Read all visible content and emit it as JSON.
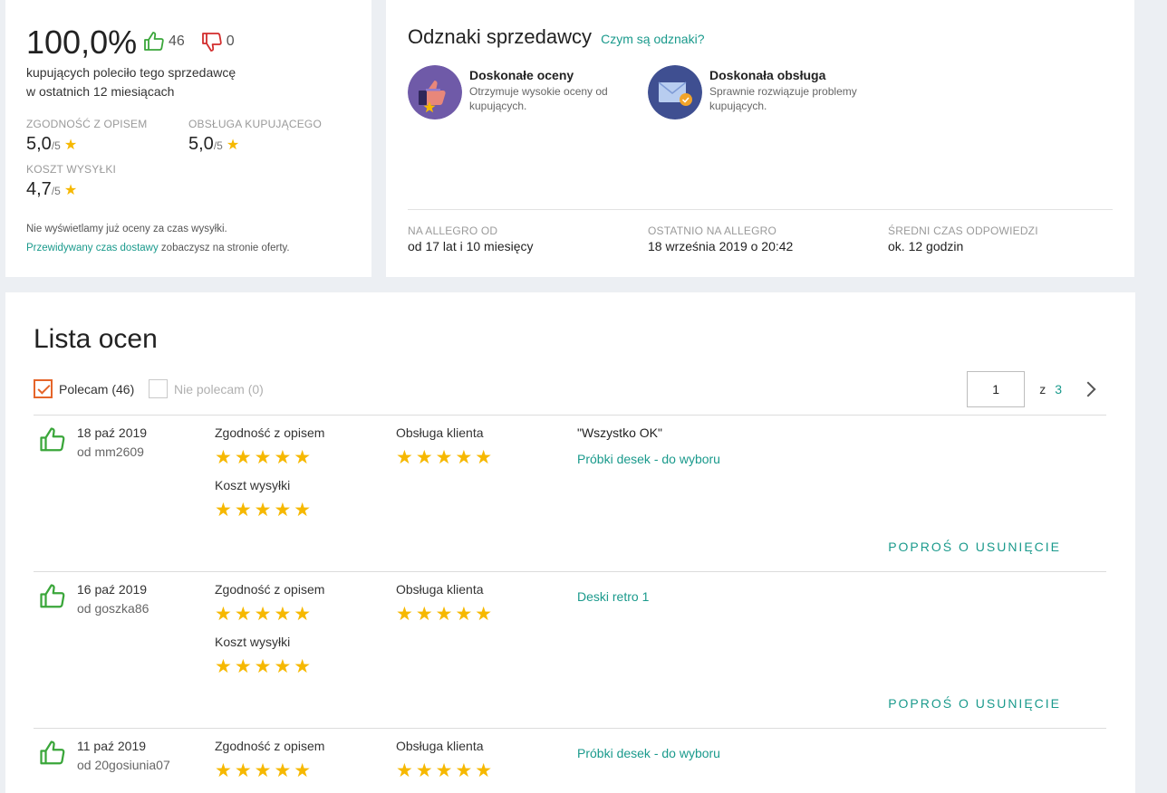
{
  "summary": {
    "percent": "100,0%",
    "positive_count": "46",
    "negative_count": "0",
    "recommend_line1": "kupujących poleciło tego sprzedawcę",
    "recommend_line2": "w ostatnich 12 miesiącach",
    "metrics": [
      {
        "label": "ZGODNOŚĆ Z OPISEM",
        "value": "5,0",
        "max": "/5"
      },
      {
        "label": "OBSŁUGA KUPUJĄCEGO",
        "value": "5,0",
        "max": "/5"
      },
      {
        "label": "KOSZT WYSYŁKI",
        "value": "4,7",
        "max": "/5"
      }
    ],
    "note_line1": "Nie wyświetlamy już oceny za czas wysyłki.",
    "note_link": "Przewidywany czas dostawy",
    "note_rest": " zobaczysz na stronie oferty."
  },
  "badges": {
    "title": "Odznaki sprzedawcy",
    "link": "Czym są odznaki?",
    "items": [
      {
        "title": "Doskonałe oceny",
        "desc": "Otrzymuje wysokie oceny od kupujących.",
        "color": "#6f5aa8"
      },
      {
        "title": "Doskonała obsługa",
        "desc": "Sprawnie rozwiązuje problemy kupujących.",
        "color": "#3f4f91"
      }
    ],
    "stats": [
      {
        "label": "NA ALLEGRO OD",
        "value": "od 17 lat i 10 miesięcy"
      },
      {
        "label": "OSTATNIO NA ALLEGRO",
        "value": "18 września 2019 o 20:42"
      },
      {
        "label": "ŚREDNI CZAS ODPOWIEDZI",
        "value": "ok. 12 godzin"
      }
    ]
  },
  "list": {
    "title": "Lista ocen",
    "filter_positive": "Polecam (46)",
    "filter_negative": "Nie polecam (0)",
    "page_current": "1",
    "page_of": "z",
    "page_total": "3",
    "col_desc": "Zgodność z opisem",
    "col_service": "Obsługa klienta",
    "col_shipping": "Koszt wysyłki",
    "stars": "★★★★★",
    "remove_label": "POPROŚ O USUNIĘCIE",
    "rows": [
      {
        "date": "18 paź 2019",
        "user": "od mm2609",
        "quote": "\"Wszystko OK\"",
        "product": "Próbki desek - do wyboru"
      },
      {
        "date": "16 paź 2019",
        "user": "od goszka86",
        "quote": "",
        "product": "Deski retro 1"
      },
      {
        "date": "11 paź 2019",
        "user": "od 20gosiunia07",
        "quote": "",
        "product": "Próbki desek - do wyboru"
      }
    ]
  },
  "colors": {
    "accent": "#1a9a8c",
    "positive": "#3aa63a",
    "negative": "#d22d2d",
    "star": "#f6b800",
    "checkbox": "#e5652a"
  }
}
